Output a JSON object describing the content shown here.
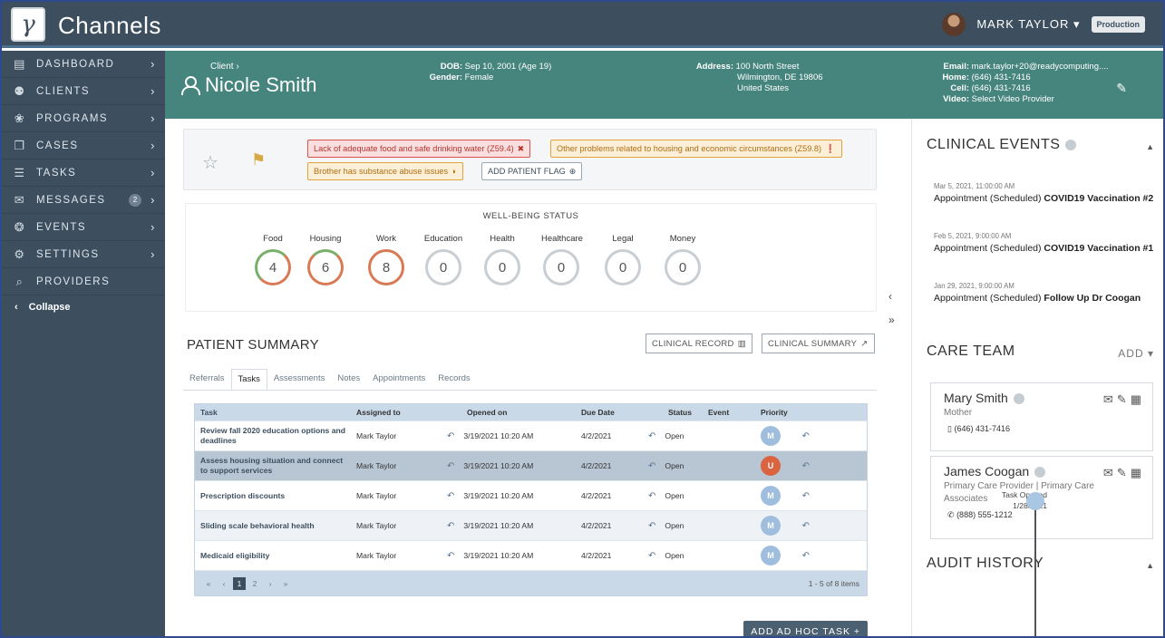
{
  "app": {
    "title": "Channels",
    "logo_glyph": "γ"
  },
  "user": {
    "name": "MARK TAYLOR",
    "environment": "Production"
  },
  "sidebar": {
    "items": [
      {
        "label": "DASHBOARD",
        "icon": "dashboard-icon",
        "glyph": "▤"
      },
      {
        "label": "CLIENTS",
        "icon": "clients-icon",
        "glyph": "⚉"
      },
      {
        "label": "PROGRAMS",
        "icon": "programs-icon",
        "glyph": "❀"
      },
      {
        "label": "CASES",
        "icon": "cases-icon",
        "glyph": "❐"
      },
      {
        "label": "TASKS",
        "icon": "tasks-icon",
        "glyph": "☰"
      },
      {
        "label": "MESSAGES",
        "icon": "messages-icon",
        "glyph": "✉",
        "count": "2"
      },
      {
        "label": "EVENTS",
        "icon": "events-icon",
        "glyph": "❂"
      },
      {
        "label": "SETTINGS",
        "icon": "settings-icon",
        "glyph": "⚙"
      },
      {
        "label": "PROVIDERS",
        "icon": "providers-icon",
        "glyph": "⌕"
      }
    ],
    "collapse": "Collapse"
  },
  "patient": {
    "client_label": "Client",
    "name": "Nicole Smith",
    "dob_label": "DOB:",
    "dob": "Sep 10, 2001 (Age 19)",
    "gender_label": "Gender:",
    "gender": "Female",
    "address_label": "Address:",
    "address_line1": "100 North Street",
    "address_line2": "Wilmington, DE 19806",
    "address_line3": "United States",
    "email_label": "Email:",
    "email": "mark.taylor+20@readycomputing....",
    "home_label": "Home:",
    "home": "(646) 431-7416",
    "cell_label": "Cell:",
    "cell": "(646) 431-7416",
    "video_label": "Video:",
    "video": "Select Video Provider"
  },
  "flags": {
    "items": [
      {
        "label": "Lack of adequate food and safe drinking water (Z59.4)",
        "icon_glyph": "✖"
      },
      {
        "label": "Other problems related to housing and economic circumstances (Z59.8)",
        "icon_glyph": "❗"
      },
      {
        "label": "Brother has substance abuse issues",
        "icon_glyph": "◗"
      }
    ],
    "add_label": "ADD PATIENT FLAG"
  },
  "wellbeing": {
    "title": "WELL-BEING STATUS",
    "categories": [
      {
        "label": "Food",
        "value": "4"
      },
      {
        "label": "Housing",
        "value": "6"
      },
      {
        "label": "Work",
        "value": "8"
      },
      {
        "label": "Education",
        "value": "0"
      },
      {
        "label": "Health",
        "value": "0"
      },
      {
        "label": "Healthcare",
        "value": "0"
      },
      {
        "label": "Legal",
        "value": "0"
      },
      {
        "label": "Money",
        "value": "0"
      }
    ]
  },
  "summary": {
    "title": "PATIENT SUMMARY",
    "clinical_record": "CLINICAL RECORD",
    "clinical_summary": "CLINICAL SUMMARY",
    "tabs": [
      "Referrals",
      "Tasks",
      "Assessments",
      "Notes",
      "Appointments",
      "Records"
    ],
    "columns": [
      "Task",
      "Assigned to",
      "Opened on",
      "Due Date",
      "Status",
      "Event",
      "Priority"
    ],
    "rows": [
      {
        "task": "Review fall 2020 education options and deadlines",
        "assigned": "Mark Taylor",
        "opened": "3/19/2021 10:20 AM",
        "due": "4/2/2021",
        "status": "Open",
        "priority": "M"
      },
      {
        "task": "Assess housing situation and connect to support services",
        "assigned": "Mark Taylor",
        "opened": "3/19/2021 10:20 AM",
        "due": "4/2/2021",
        "status": "Open",
        "priority": "U"
      },
      {
        "task": "Prescription discounts",
        "assigned": "Mark Taylor",
        "opened": "3/19/2021 10:20 AM",
        "due": "4/2/2021",
        "status": "Open",
        "priority": "M"
      },
      {
        "task": "Sliding scale behavioral health",
        "assigned": "Mark Taylor",
        "opened": "3/19/2021 10:20 AM",
        "due": "4/2/2021",
        "status": "Open",
        "priority": "M"
      },
      {
        "task": "Medicaid eligibility",
        "assigned": "Mark Taylor",
        "opened": "3/19/2021 10:20 AM",
        "due": "4/2/2021",
        "status": "Open",
        "priority": "M"
      }
    ],
    "pager": {
      "first": "«",
      "prev": "‹",
      "pages": [
        "1",
        "2"
      ],
      "next": "›",
      "last": "»",
      "info": "1 - 5 of 8 items"
    },
    "add_task": "ADD AD HOC TASK +"
  },
  "clinical_events": {
    "title": "CLINICAL EVENTS",
    "items": [
      {
        "time": "Mar 5, 2021, 11:00:00 AM",
        "type": "Appointment (Scheduled)",
        "name": "COVID19 Vaccination #2"
      },
      {
        "time": "Feb 5, 2021, 9:00:00 AM",
        "type": "Appointment (Scheduled)",
        "name": "COVID19 Vaccination #1"
      },
      {
        "time": "Jan 29, 2021, 9:00:00 AM",
        "type": "Appointment (Scheduled)",
        "name": "Follow Up Dr Coogan"
      }
    ]
  },
  "care_team": {
    "title": "CARE TEAM",
    "add": "ADD",
    "members": [
      {
        "name": "Mary Smith",
        "role": "Mother",
        "phone": "(646) 431-7416"
      },
      {
        "name": "James Coogan",
        "role": "Primary Care Provider  |  Primary Care Associates",
        "phone": "(888) 555-1212"
      }
    ]
  },
  "audit": {
    "title": "AUDIT HISTORY",
    "entry_label": "Task Opened",
    "entry_date": "1/28/2021"
  },
  "colors": {
    "sidebar": "#3d4f5f",
    "header": "#46857e",
    "accent_red": "#d9643f",
    "accent_green": "#7aaf6a"
  }
}
